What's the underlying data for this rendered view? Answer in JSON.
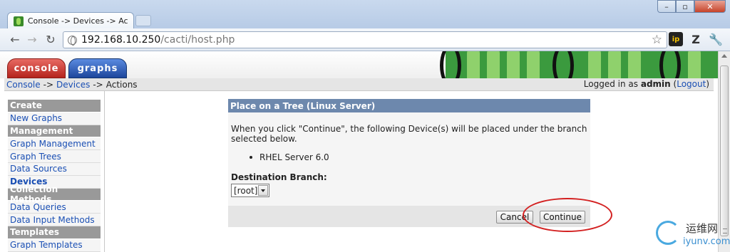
{
  "browser": {
    "tab_title": "Console -> Devices -> Ac",
    "url_host": "192.168.10.250",
    "url_path": "/cacti/host.php",
    "extensions": [
      "ip",
      "Z"
    ]
  },
  "cacti": {
    "tabs": [
      "console",
      "graphs"
    ],
    "breadcrumb": {
      "console": "Console",
      "sep": "->",
      "devices": "Devices",
      "current": "Actions"
    },
    "login": {
      "prefix": "Logged in as",
      "user": "admin",
      "logout": "Logout"
    }
  },
  "sidebar": {
    "items": [
      {
        "label": "Create",
        "kind": "head"
      },
      {
        "label": "New Graphs",
        "kind": "item"
      },
      {
        "label": "Management",
        "kind": "head"
      },
      {
        "label": "Graph Management",
        "kind": "item"
      },
      {
        "label": "Graph Trees",
        "kind": "item"
      },
      {
        "label": "Data Sources",
        "kind": "item"
      },
      {
        "label": "Devices",
        "kind": "active"
      },
      {
        "label": "Collection Methods",
        "kind": "head"
      },
      {
        "label": "Data Queries",
        "kind": "item"
      },
      {
        "label": "Data Input Methods",
        "kind": "item"
      },
      {
        "label": "Templates",
        "kind": "head"
      },
      {
        "label": "Graph Templates",
        "kind": "item"
      }
    ]
  },
  "dialog": {
    "title": "Place on a Tree (Linux Server)",
    "message": "When you click \"Continue\", the following Device(s) will be placed under the branch selected below.",
    "devices": [
      "RHEL Server 6.0"
    ],
    "branch_label": "Destination Branch:",
    "branch_value": "[root]",
    "cancel_label": "Cancel",
    "continue_label": "Continue"
  },
  "watermark": {
    "cn": "运维网",
    "en": "iyunv.com"
  },
  "colors": {
    "dialog_header": "#6d88ad",
    "sidebar_head": "#999999",
    "link": "#1a4fb4",
    "highlight": "#d32020"
  }
}
